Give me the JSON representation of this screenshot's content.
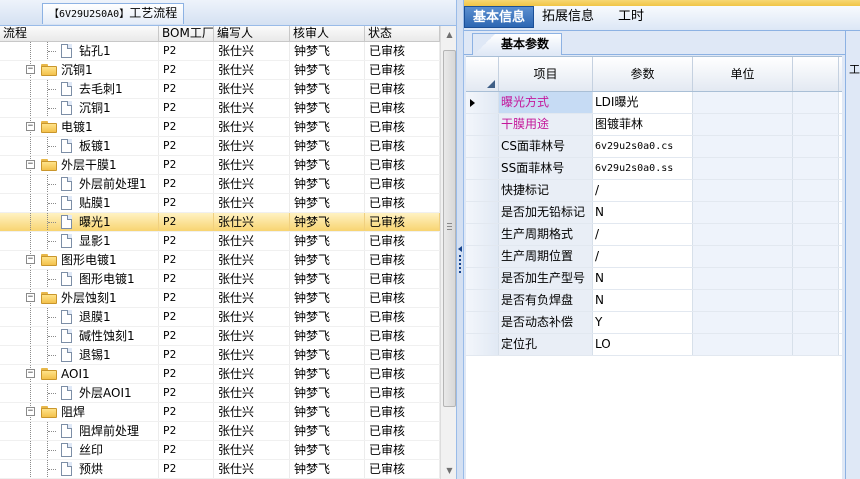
{
  "left_panel": {
    "title": {
      "code": "【6V29U2S0A0】",
      "label": "工艺流程"
    },
    "columns": [
      "流程",
      "BOM工厂",
      "编写人",
      "核审人",
      "状态"
    ],
    "rows": [
      {
        "name": "钻孔1",
        "level": 2,
        "type": "doc",
        "bom": "P2",
        "writer": "张仕兴",
        "auditor": "钟梦飞",
        "status": "已审核"
      },
      {
        "name": "沉铜1",
        "level": 1,
        "type": "folder",
        "bom": "P2",
        "writer": "张仕兴",
        "auditor": "钟梦飞",
        "status": "已审核"
      },
      {
        "name": "去毛刺1",
        "level": 2,
        "type": "doc",
        "bom": "P2",
        "writer": "张仕兴",
        "auditor": "钟梦飞",
        "status": "已审核"
      },
      {
        "name": "沉铜1",
        "level": 2,
        "type": "doc",
        "bom": "P2",
        "writer": "张仕兴",
        "auditor": "钟梦飞",
        "status": "已审核"
      },
      {
        "name": "电镀1",
        "level": 1,
        "type": "folder",
        "bom": "P2",
        "writer": "张仕兴",
        "auditor": "钟梦飞",
        "status": "已审核"
      },
      {
        "name": "板镀1",
        "level": 2,
        "type": "doc",
        "bom": "P2",
        "writer": "张仕兴",
        "auditor": "钟梦飞",
        "status": "已审核"
      },
      {
        "name": "外层干膜1",
        "level": 1,
        "type": "folder",
        "bom": "P2",
        "writer": "张仕兴",
        "auditor": "钟梦飞",
        "status": "已审核"
      },
      {
        "name": "外层前处理1",
        "level": 2,
        "type": "doc",
        "bom": "P2",
        "writer": "张仕兴",
        "auditor": "钟梦飞",
        "status": "已审核"
      },
      {
        "name": "贴膜1",
        "level": 2,
        "type": "doc",
        "bom": "P2",
        "writer": "张仕兴",
        "auditor": "钟梦飞",
        "status": "已审核"
      },
      {
        "name": "曝光1",
        "level": 2,
        "type": "doc",
        "bom": "P2",
        "writer": "张仕兴",
        "auditor": "钟梦飞",
        "status": "已审核",
        "selected": true
      },
      {
        "name": "显影1",
        "level": 2,
        "type": "doc",
        "bom": "P2",
        "writer": "张仕兴",
        "auditor": "钟梦飞",
        "status": "已审核"
      },
      {
        "name": "图形电镀1",
        "level": 1,
        "type": "folder",
        "bom": "P2",
        "writer": "张仕兴",
        "auditor": "钟梦飞",
        "status": "已审核"
      },
      {
        "name": "图形电镀1",
        "level": 2,
        "type": "doc",
        "bom": "P2",
        "writer": "张仕兴",
        "auditor": "钟梦飞",
        "status": "已审核"
      },
      {
        "name": "外层蚀刻1",
        "level": 1,
        "type": "folder",
        "bom": "P2",
        "writer": "张仕兴",
        "auditor": "钟梦飞",
        "status": "已审核"
      },
      {
        "name": "退膜1",
        "level": 2,
        "type": "doc",
        "bom": "P2",
        "writer": "张仕兴",
        "auditor": "钟梦飞",
        "status": "已审核"
      },
      {
        "name": "碱性蚀刻1",
        "level": 2,
        "type": "doc",
        "bom": "P2",
        "writer": "张仕兴",
        "auditor": "钟梦飞",
        "status": "已审核"
      },
      {
        "name": "退锡1",
        "level": 2,
        "type": "doc",
        "bom": "P2",
        "writer": "张仕兴",
        "auditor": "钟梦飞",
        "status": "已审核"
      },
      {
        "name": "AOI1",
        "level": 1,
        "type": "folder",
        "bom": "P2",
        "writer": "张仕兴",
        "auditor": "钟梦飞",
        "status": "已审核"
      },
      {
        "name": "外层AOI1",
        "level": 2,
        "type": "doc",
        "bom": "P2",
        "writer": "张仕兴",
        "auditor": "钟梦飞",
        "status": "已审核"
      },
      {
        "name": "阻焊",
        "level": 1,
        "type": "folder",
        "bom": "P2",
        "writer": "张仕兴",
        "auditor": "钟梦飞",
        "status": "已审核"
      },
      {
        "name": "阻焊前处理",
        "level": 2,
        "type": "doc",
        "bom": "P2",
        "writer": "张仕兴",
        "auditor": "钟梦飞",
        "status": "已审核"
      },
      {
        "name": "丝印",
        "level": 2,
        "type": "doc",
        "bom": "P2",
        "writer": "张仕兴",
        "auditor": "钟梦飞",
        "status": "已审核"
      },
      {
        "name": "预烘",
        "level": 2,
        "type": "doc",
        "bom": "P2",
        "writer": "张仕兴",
        "auditor": "钟梦飞",
        "status": "已审核"
      }
    ]
  },
  "right_panel": {
    "tabs": [
      "基本信息",
      "拓展信息",
      "工时"
    ],
    "active_tab": "基本信息",
    "subtab": "基本参数",
    "columns": [
      "项目",
      "参数",
      "单位"
    ],
    "rows": [
      {
        "item": "曝光方式",
        "param": "LDI曝光",
        "unit": "",
        "highlight": true,
        "current": true
      },
      {
        "item": "干膜用途",
        "param": "图镀菲林",
        "unit": "",
        "highlight": true
      },
      {
        "item": "CS面菲林号",
        "param": "6v29u2s0a0.cs",
        "unit": ""
      },
      {
        "item": "SS面菲林号",
        "param": "6v29u2s0a0.ss",
        "unit": ""
      },
      {
        "item": "快捷标记",
        "param": "/",
        "unit": ""
      },
      {
        "item": "是否加无铅标记",
        "param": "N",
        "unit": ""
      },
      {
        "item": "生产周期格式",
        "param": "/",
        "unit": ""
      },
      {
        "item": "生产周期位置",
        "param": "/",
        "unit": ""
      },
      {
        "item": "是否加生产型号",
        "param": "N",
        "unit": ""
      },
      {
        "item": "是否有负焊盘",
        "param": "N",
        "unit": ""
      },
      {
        "item": "是否动态补偿",
        "param": "Y",
        "unit": ""
      },
      {
        "item": "定位孔",
        "param": "LO",
        "unit": ""
      }
    ],
    "edge_tab": "工"
  },
  "colors": {
    "accent": "#f1c445",
    "selected_row": "#f8d471",
    "highlight_text": "#c4179b",
    "tab_active": "#2d67b3"
  }
}
